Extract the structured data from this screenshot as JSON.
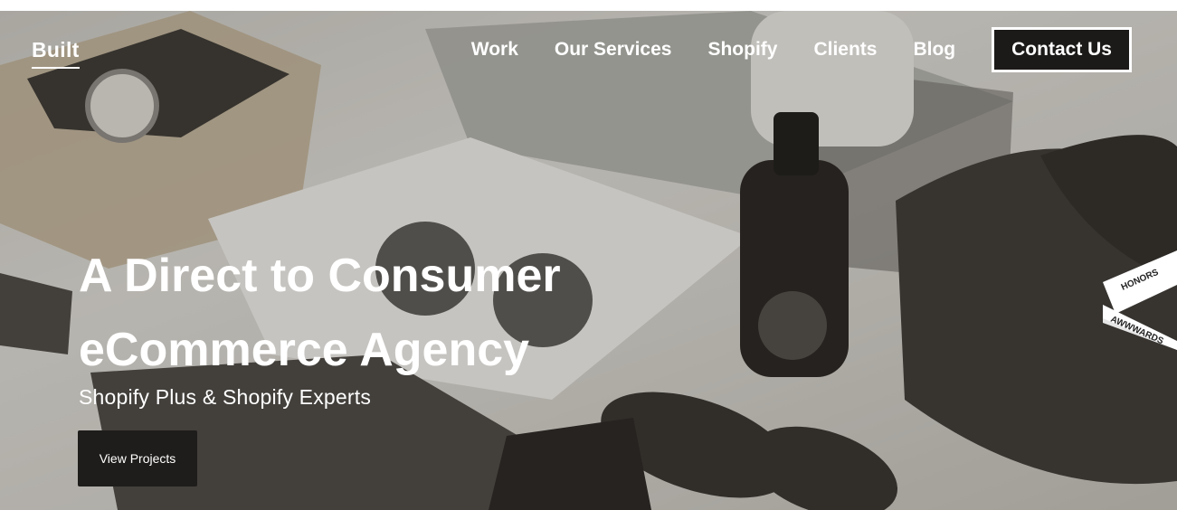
{
  "brand": {
    "logo_text": "Built"
  },
  "nav": {
    "items": [
      {
        "label": "Work"
      },
      {
        "label": "Our Services"
      },
      {
        "label": "Shopify"
      },
      {
        "label": "Clients"
      },
      {
        "label": "Blog"
      }
    ],
    "contact_label": "Contact Us"
  },
  "hero": {
    "headline_line1": "A Direct to Consumer",
    "headline_line2": "eCommerce Agency",
    "subheadline": "Shopify Plus & Shopify Experts",
    "cta_label": "View Projects"
  },
  "awards_badge": {
    "line1": "HONORS",
    "line2": "AWWWARDS"
  },
  "colors": {
    "accent_dark": "#1c1a18",
    "text_light": "#ffffff"
  }
}
